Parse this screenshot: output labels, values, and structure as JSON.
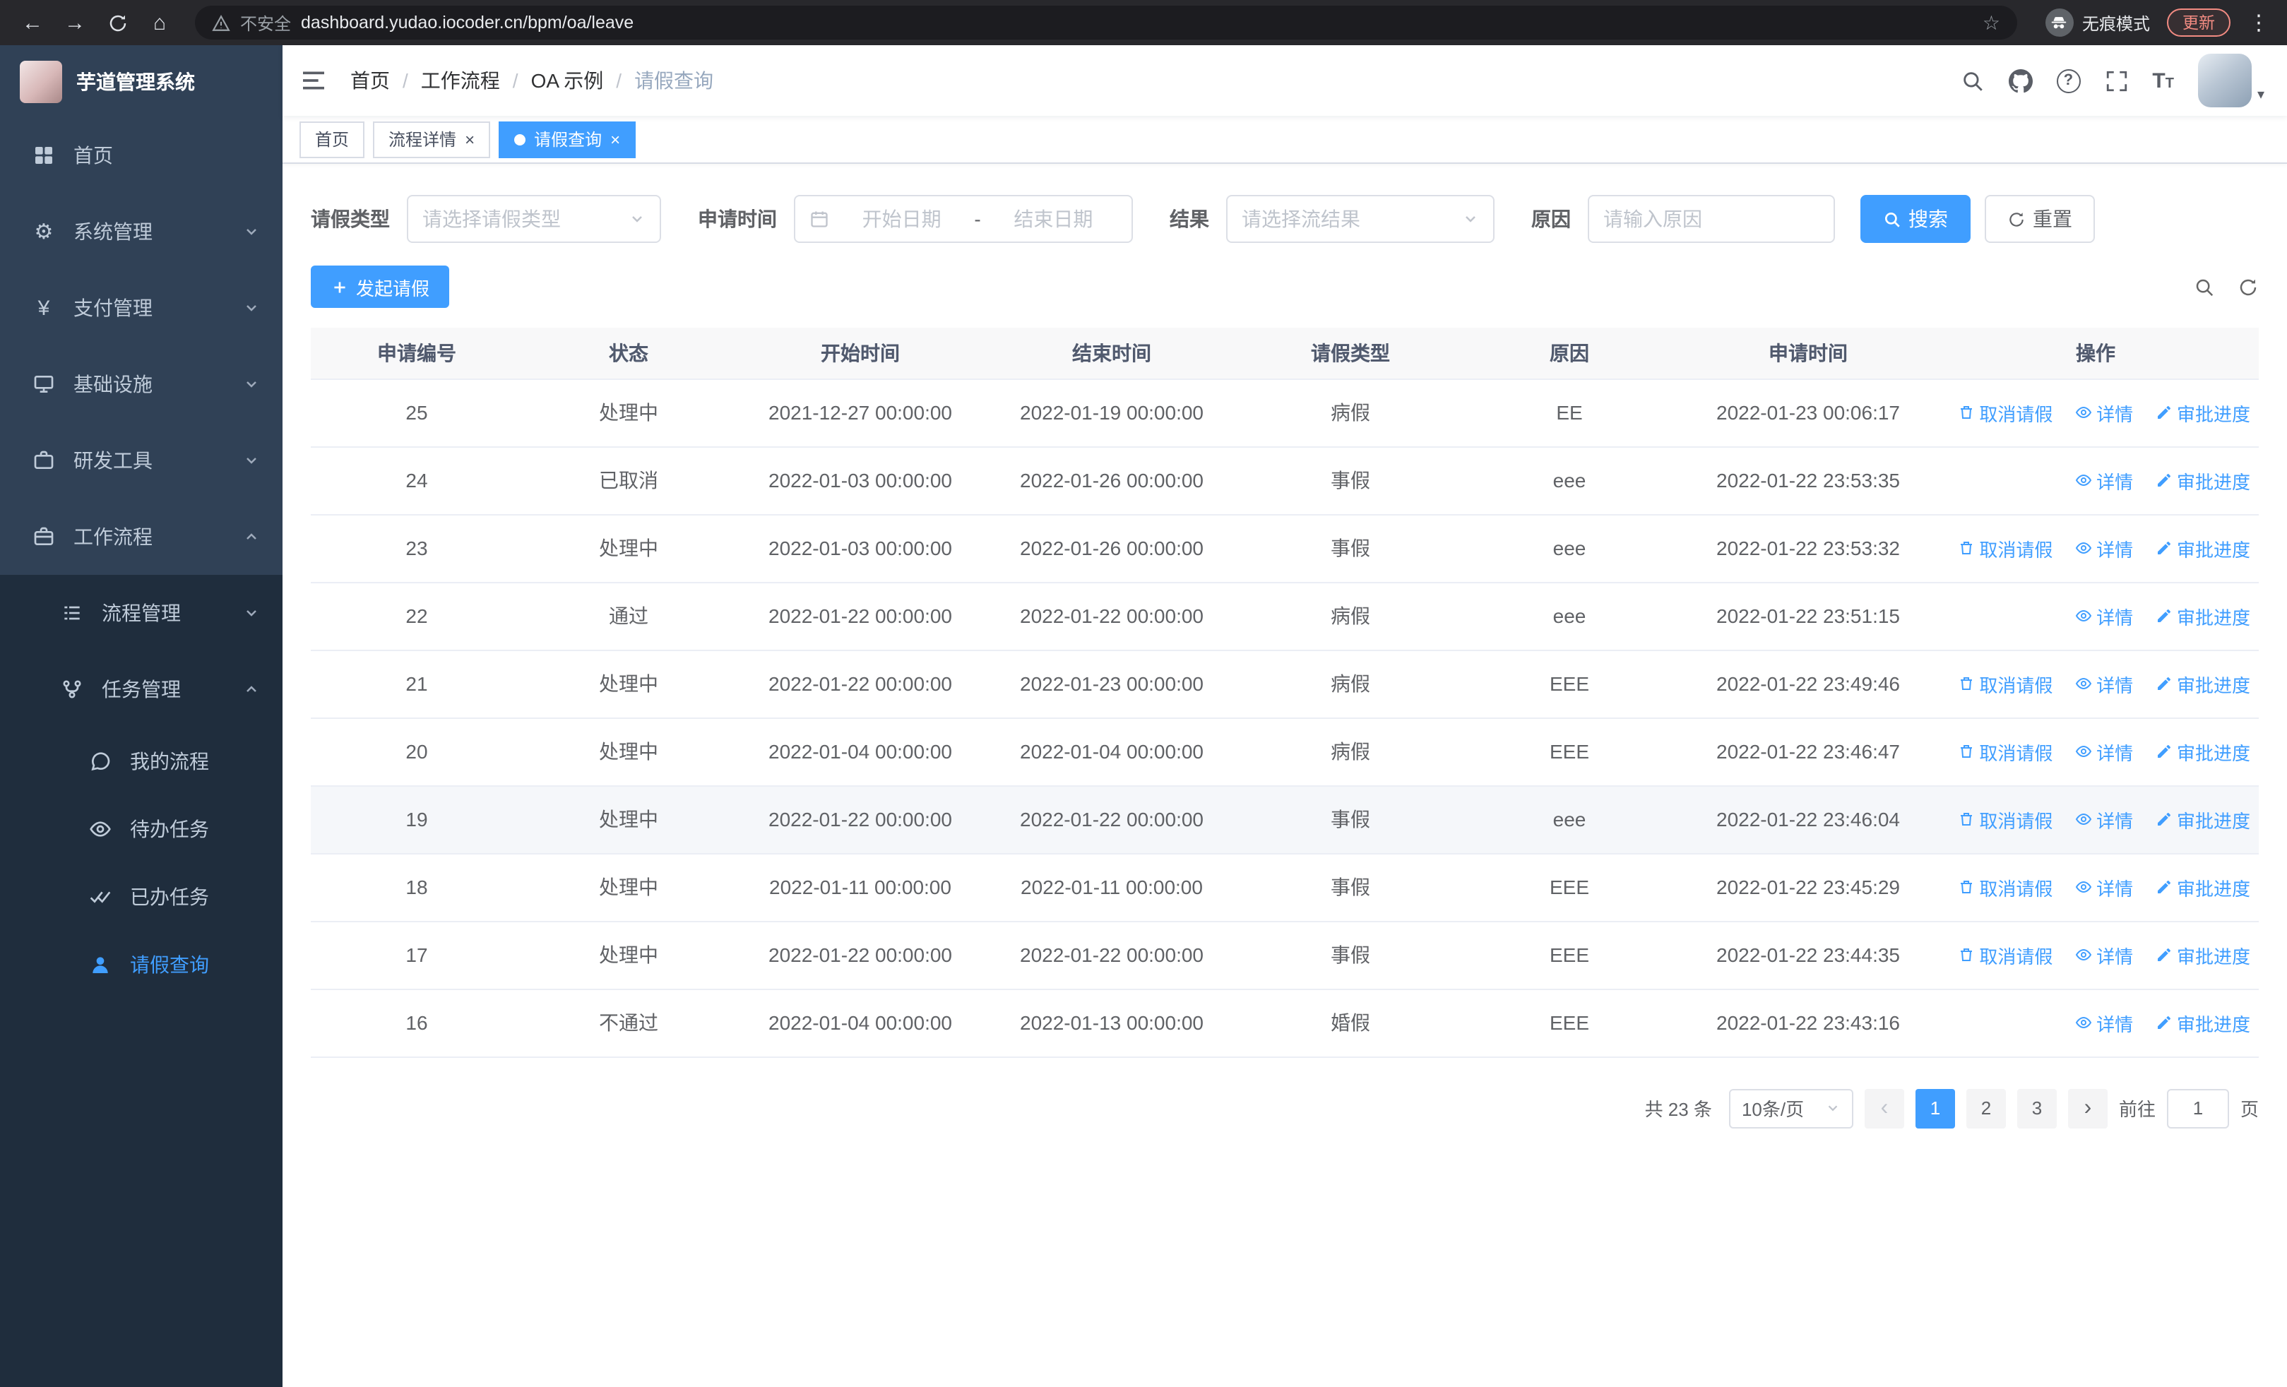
{
  "browser": {
    "security_label": "不安全",
    "url": "dashboard.yudao.iocoder.cn/bpm/oa/leave",
    "incognito_label": "无痕模式",
    "update_label": "更新"
  },
  "app_title": "芋道管理系统",
  "sidebar": {
    "items": [
      {
        "label": "首页"
      },
      {
        "label": "系统管理"
      },
      {
        "label": "支付管理"
      },
      {
        "label": "基础设施"
      },
      {
        "label": "研发工具"
      },
      {
        "label": "工作流程"
      },
      {
        "label": "流程管理"
      },
      {
        "label": "任务管理"
      },
      {
        "label": "我的流程"
      },
      {
        "label": "待办任务"
      },
      {
        "label": "已办任务"
      },
      {
        "label": "请假查询"
      }
    ]
  },
  "breadcrumb": [
    "首页",
    "工作流程",
    "OA 示例",
    "请假查询"
  ],
  "tabs": [
    {
      "label": "首页"
    },
    {
      "label": "流程详情"
    },
    {
      "label": "请假查询"
    }
  ],
  "filters": {
    "leave_type_label": "请假类型",
    "leave_type_placeholder": "请选择请假类型",
    "apply_time_label": "申请时间",
    "start_date_placeholder": "开始日期",
    "range_separator": "-",
    "end_date_placeholder": "结束日期",
    "result_label": "结果",
    "result_placeholder": "请选择流结果",
    "reason_label": "原因",
    "reason_placeholder": "请输入原因",
    "search_label": "搜索",
    "reset_label": "重置"
  },
  "toolbar": {
    "create_label": "发起请假"
  },
  "table": {
    "columns": [
      "申请编号",
      "状态",
      "开始时间",
      "结束时间",
      "请假类型",
      "原因",
      "申请时间",
      "操作"
    ],
    "actions": {
      "cancel": "取消请假",
      "detail": "详情",
      "progress": "审批进度"
    },
    "rows": [
      {
        "id": "25",
        "status": "处理中",
        "start": "2021-12-27 00:00:00",
        "end": "2022-01-19 00:00:00",
        "type": "病假",
        "reason": "EE",
        "applied": "2022-01-23 00:06:17",
        "can_cancel": true,
        "highlight": false
      },
      {
        "id": "24",
        "status": "已取消",
        "start": "2022-01-03 00:00:00",
        "end": "2022-01-26 00:00:00",
        "type": "事假",
        "reason": "eee",
        "applied": "2022-01-22 23:53:35",
        "can_cancel": false,
        "highlight": false
      },
      {
        "id": "23",
        "status": "处理中",
        "start": "2022-01-03 00:00:00",
        "end": "2022-01-26 00:00:00",
        "type": "事假",
        "reason": "eee",
        "applied": "2022-01-22 23:53:32",
        "can_cancel": true,
        "highlight": false
      },
      {
        "id": "22",
        "status": "通过",
        "start": "2022-01-22 00:00:00",
        "end": "2022-01-22 00:00:00",
        "type": "病假",
        "reason": "eee",
        "applied": "2022-01-22 23:51:15",
        "can_cancel": false,
        "highlight": false
      },
      {
        "id": "21",
        "status": "处理中",
        "start": "2022-01-22 00:00:00",
        "end": "2022-01-23 00:00:00",
        "type": "病假",
        "reason": "EEE",
        "applied": "2022-01-22 23:49:46",
        "can_cancel": true,
        "highlight": false
      },
      {
        "id": "20",
        "status": "处理中",
        "start": "2022-01-04 00:00:00",
        "end": "2022-01-04 00:00:00",
        "type": "病假",
        "reason": "EEE",
        "applied": "2022-01-22 23:46:47",
        "can_cancel": true,
        "highlight": false
      },
      {
        "id": "19",
        "status": "处理中",
        "start": "2022-01-22 00:00:00",
        "end": "2022-01-22 00:00:00",
        "type": "事假",
        "reason": "eee",
        "applied": "2022-01-22 23:46:04",
        "can_cancel": true,
        "highlight": true
      },
      {
        "id": "18",
        "status": "处理中",
        "start": "2022-01-11 00:00:00",
        "end": "2022-01-11 00:00:00",
        "type": "事假",
        "reason": "EEE",
        "applied": "2022-01-22 23:45:29",
        "can_cancel": true,
        "highlight": false
      },
      {
        "id": "17",
        "status": "处理中",
        "start": "2022-01-22 00:00:00",
        "end": "2022-01-22 00:00:00",
        "type": "事假",
        "reason": "EEE",
        "applied": "2022-01-22 23:44:35",
        "can_cancel": true,
        "highlight": false
      },
      {
        "id": "16",
        "status": "不通过",
        "start": "2022-01-04 00:00:00",
        "end": "2022-01-13 00:00:00",
        "type": "婚假",
        "reason": "EEE",
        "applied": "2022-01-22 23:43:16",
        "can_cancel": false,
        "highlight": false
      }
    ]
  },
  "pagination": {
    "total": "共 23 条",
    "page_size": "10条/页",
    "pages": [
      "1",
      "2",
      "3"
    ],
    "goto_label": "前往",
    "goto_value": "1",
    "goto_suffix": "页"
  }
}
